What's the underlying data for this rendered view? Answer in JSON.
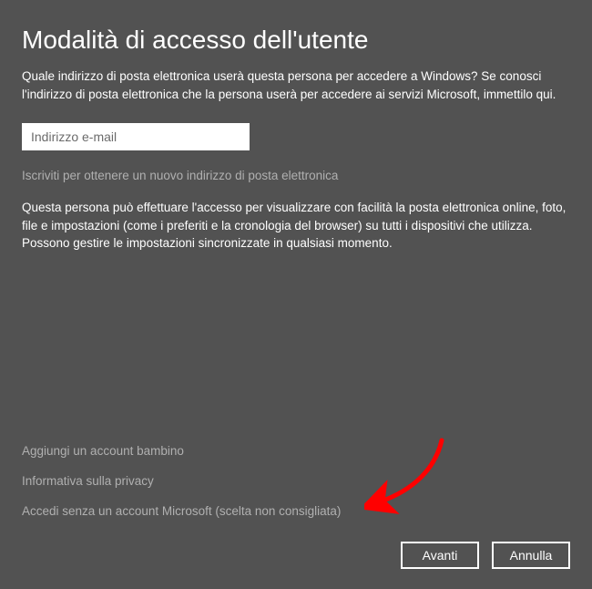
{
  "title": "Modalità di accesso dell'utente",
  "intro": "Quale indirizzo di posta elettronica userà questa persona per accedere a Windows? Se conosci l'indirizzo di posta elettronica che la persona userà per accedere ai servizi Microsoft, immettilo qui.",
  "email": {
    "placeholder": "Indirizzo e-mail",
    "value": ""
  },
  "signup_link": "Iscriviti per ottenere un nuovo indirizzo di posta elettronica",
  "paragraph": "Questa persona può effettuare l'accesso per visualizzare con facilità la posta elettronica online, foto, file e impostazioni (come i preferiti e la cronologia del browser) su tutti i dispositivi che utilizza. Possono gestire le impostazioni sincronizzate in qualsiasi momento.",
  "links": {
    "add_child": "Aggiungi un account bambino",
    "privacy": "Informativa sulla privacy",
    "no_ms_account": "Accedi senza un account Microsoft (scelta non consigliata)"
  },
  "buttons": {
    "next": "Avanti",
    "cancel": "Annulla"
  },
  "colors": {
    "bg": "#525252",
    "text": "#ffffff",
    "muted": "#b0b0b0",
    "accent_arrow": "#ff0000"
  }
}
